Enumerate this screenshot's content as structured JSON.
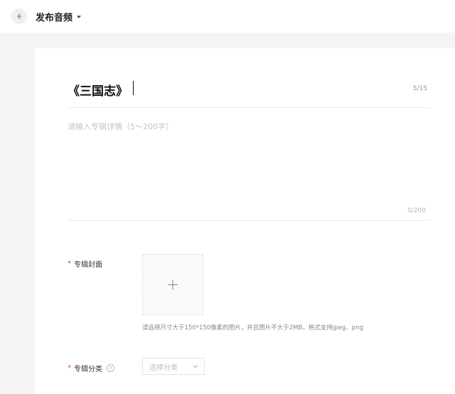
{
  "header": {
    "title": "发布音频",
    "back_icon": "arrow-left-icon",
    "dropdown_icon": "caret-down-icon"
  },
  "form": {
    "album_title": {
      "value": "《三国志》",
      "counter": "5/15"
    },
    "album_detail": {
      "placeholder": "请输入专辑详情（5～200字）",
      "value": "",
      "counter": "0/200"
    },
    "cover": {
      "required_mark": "*",
      "label": "专辑封面",
      "upload_icon": "plus-icon",
      "hint": "请选择尺寸大于150*150像素的图片，并且图片不大于2MB，格式支持jpeg、png"
    },
    "category": {
      "required_mark": "*",
      "label": "专辑分类",
      "help_icon": "question-circle-icon",
      "help_glyph": "?",
      "select_placeholder": "选择分类",
      "select_icon": "chevron-down-icon"
    }
  },
  "colors": {
    "page_background": "#f4f4f4",
    "card_background": "#ffffff",
    "required": "#e0443b",
    "placeholder": "#c4c4c4"
  }
}
